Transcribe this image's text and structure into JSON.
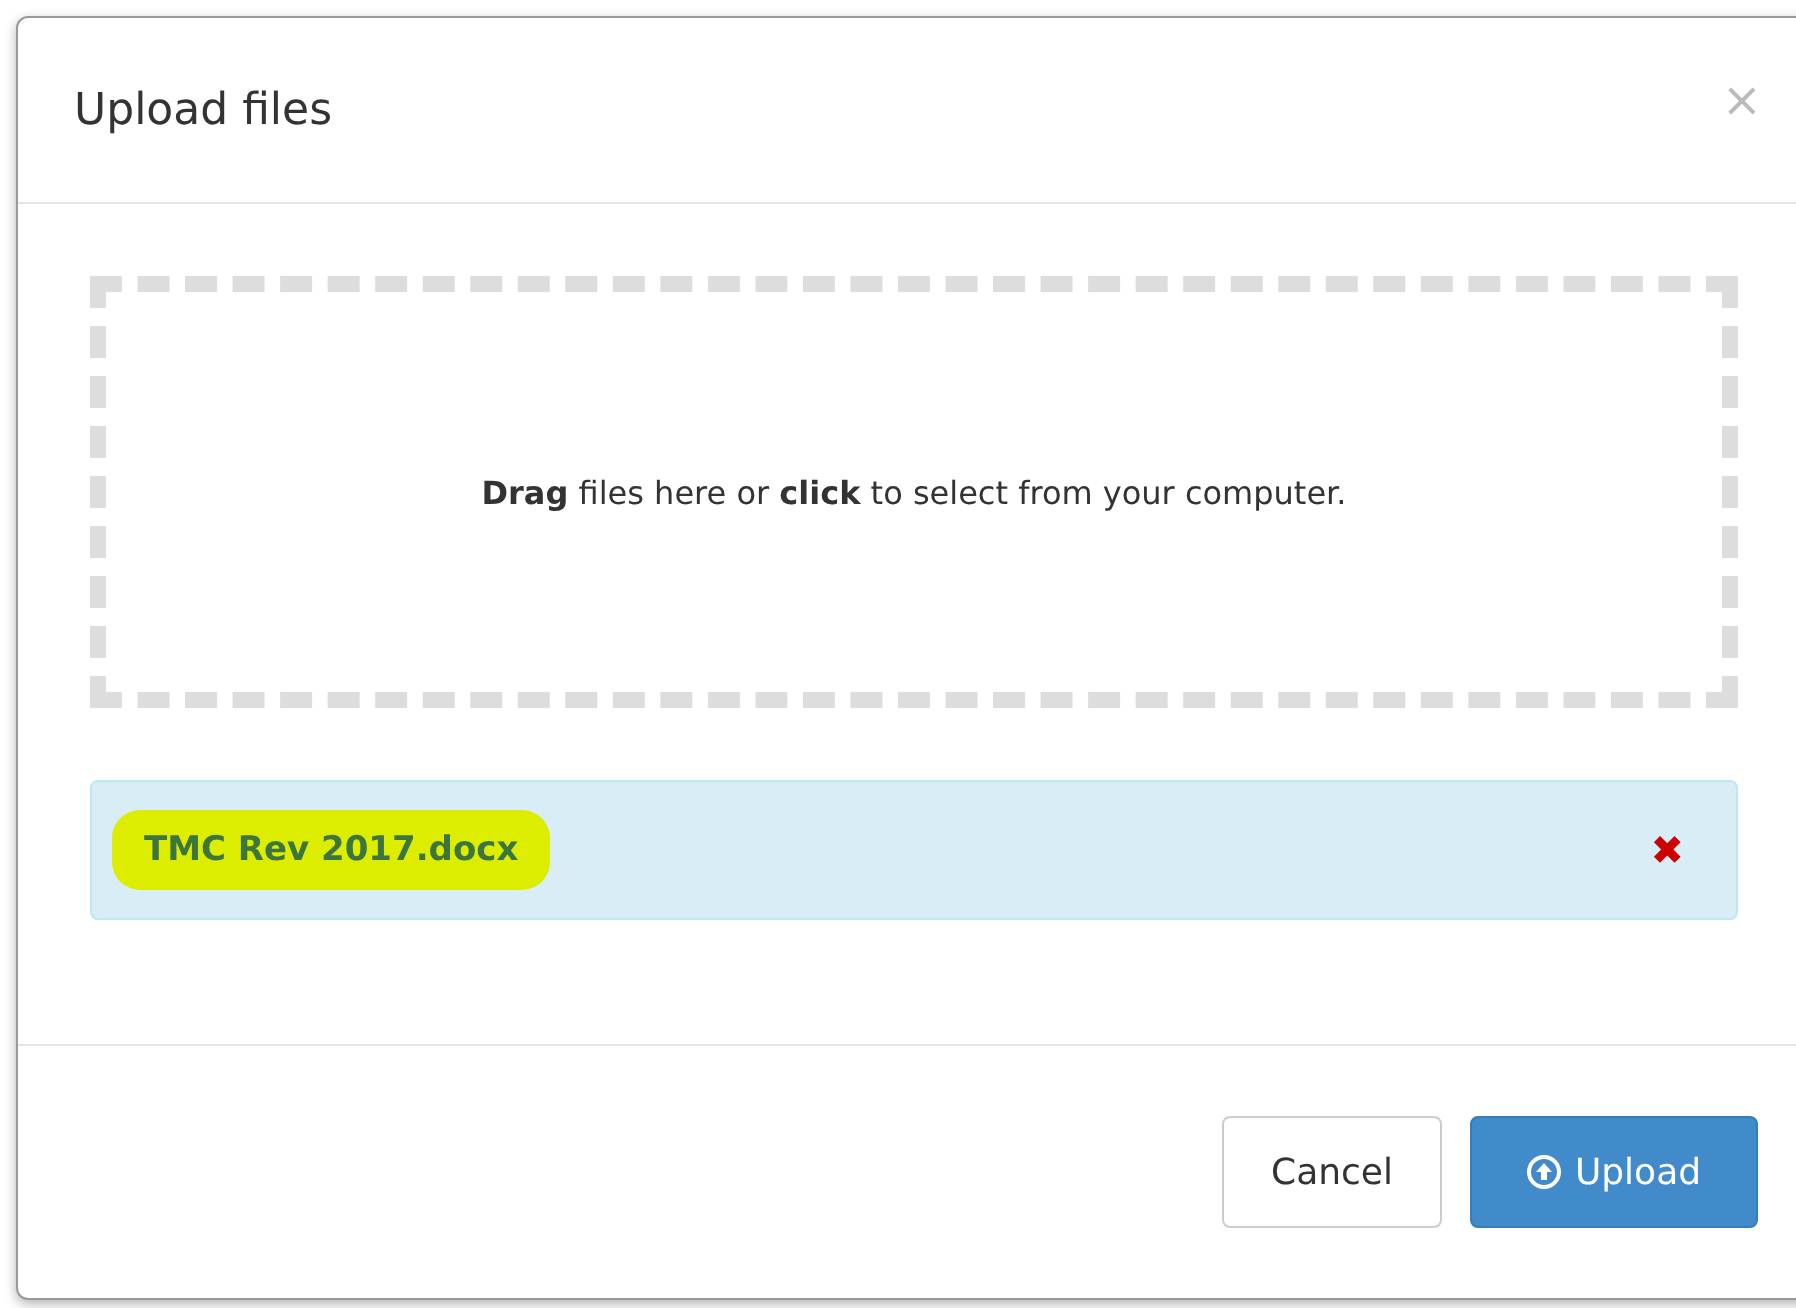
{
  "dialog": {
    "title": "Upload files",
    "close": "×"
  },
  "dropzone": {
    "text": "**Drag** files here or **click** to select from your computer."
  },
  "files": [
    {
      "name": "TMC Rev 2017.docx",
      "highlighted": true,
      "remove": "✖"
    }
  ],
  "buttons": [
    {
      "label": "Cancel",
      "kind": "default"
    },
    {
      "label": "Upload",
      "kind": "primary"
    }
  ]
}
